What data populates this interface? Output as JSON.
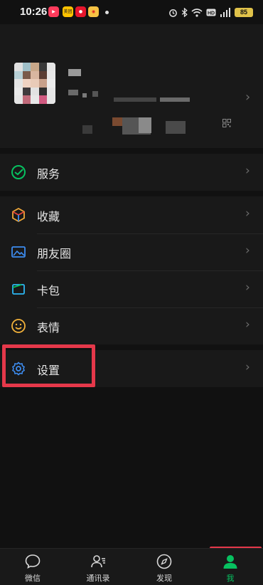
{
  "status_bar": {
    "time": "10:26",
    "battery": "85",
    "app_badges": [
      "video-app",
      "meituan-app",
      "weibo-app",
      "weibo-alt-app"
    ],
    "meituan_label": "美团"
  },
  "profile": {
    "qr_icon": "qr-code-icon"
  },
  "menu": {
    "services": {
      "label": "服务",
      "icon": "services-check-icon",
      "color": "#07c160"
    },
    "favorites": {
      "label": "收藏",
      "icon": "favorites-cube-icon"
    },
    "moments": {
      "label": "朋友圈",
      "icon": "moments-photo-icon",
      "color": "#3d8cf0"
    },
    "cards": {
      "label": "卡包",
      "icon": "card-wallet-icon",
      "color": "#2cb7f3"
    },
    "stickers": {
      "label": "表情",
      "icon": "sticker-smile-icon",
      "color": "#f3b23a"
    },
    "settings": {
      "label": "设置",
      "icon": "settings-gear-icon",
      "color": "#3d8cf0"
    }
  },
  "tabbar": {
    "tabs": [
      {
        "label": "微信",
        "icon": "chat-bubble-icon"
      },
      {
        "label": "通讯录",
        "icon": "contacts-icon"
      },
      {
        "label": "发现",
        "icon": "compass-icon"
      },
      {
        "label": "我",
        "icon": "person-icon",
        "active": true
      }
    ],
    "accent_color": "#07c160"
  },
  "annotation_color": "#e5384a"
}
